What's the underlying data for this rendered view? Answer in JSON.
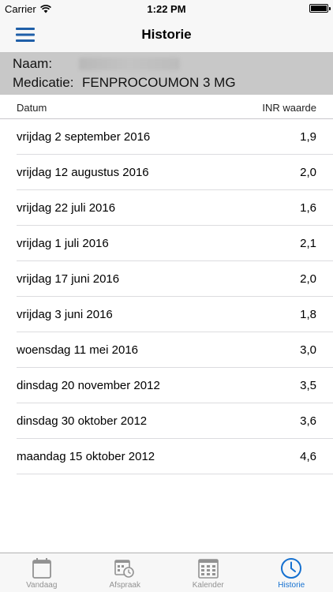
{
  "status_bar": {
    "carrier": "Carrier",
    "time": "1:22 PM"
  },
  "nav": {
    "title": "Historie",
    "accent_color": "#1f5fa8"
  },
  "patient": {
    "name_label": "Naam:",
    "medication_label": "Medicatie:",
    "medication_value": "FENPROCOUMON 3 MG"
  },
  "table": {
    "header_date": "Datum",
    "header_value": "INR waarde",
    "rows": [
      {
        "date": "vrijdag 2 september 2016",
        "value": "1,9"
      },
      {
        "date": "vrijdag 12 augustus 2016",
        "value": "2,0"
      },
      {
        "date": "vrijdag 22 juli 2016",
        "value": "1,6"
      },
      {
        "date": "vrijdag 1 juli 2016",
        "value": "2,1"
      },
      {
        "date": "vrijdag 17 juni 2016",
        "value": "2,0"
      },
      {
        "date": "vrijdag 3 juni 2016",
        "value": "1,8"
      },
      {
        "date": "woensdag 11 mei 2016",
        "value": "3,0"
      },
      {
        "date": "dinsdag 20 november 2012",
        "value": "3,5"
      },
      {
        "date": "dinsdag 30 oktober 2012",
        "value": "3,6"
      },
      {
        "date": "maandag 15 oktober 2012",
        "value": "4,6"
      }
    ]
  },
  "tabs": [
    {
      "label": "Vandaag",
      "icon": "calendar-page-icon",
      "active": false
    },
    {
      "label": "Afspraak",
      "icon": "calendar-clock-icon",
      "active": false
    },
    {
      "label": "Kalender",
      "icon": "calendar-grid-icon",
      "active": false
    },
    {
      "label": "Historie",
      "icon": "clock-icon",
      "active": true
    }
  ],
  "colors": {
    "tab_active": "#1470d0",
    "tab_inactive": "#929292",
    "patient_bg": "#c8c8c8"
  }
}
